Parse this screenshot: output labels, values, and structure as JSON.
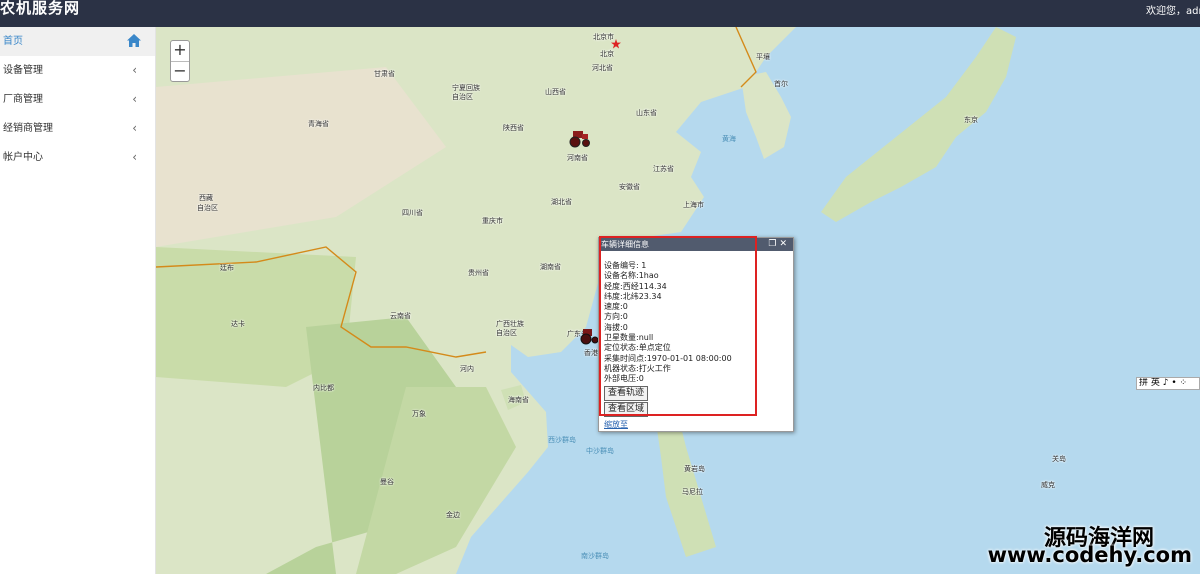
{
  "app": {
    "title": "农机服务网",
    "welcome": "欢迎您，admin"
  },
  "sidebar": {
    "items": [
      {
        "label": "首页",
        "icon": "home-icon",
        "active": true
      },
      {
        "label": "设备管理",
        "icon": "chevron-left-icon"
      },
      {
        "label": "厂商管理",
        "icon": "chevron-left-icon"
      },
      {
        "label": "经销商管理",
        "icon": "chevron-left-icon"
      },
      {
        "label": "帐户中心",
        "icon": "chevron-left-icon"
      }
    ]
  },
  "map": {
    "zoom_in": "+",
    "zoom_out": "−",
    "labels": {
      "beijing_city": "北京市",
      "beijing": "北京",
      "hebei": "河北省",
      "shanxi": "山西省",
      "gansu": "甘肃省",
      "ningxia": "宁夏回族",
      "ningxia2": "自治区",
      "qinghai": "青海省",
      "shaanxi": "陕西省",
      "henan": "河南省",
      "shandong": "山东省",
      "jiangsu": "江苏省",
      "anhui": "安徽省",
      "shanghai": "上海市",
      "hubei": "湖北省",
      "sichuan": "四川省",
      "chongqing": "重庆市",
      "hunan": "湖南省",
      "guizhou": "贵州省",
      "yunnan": "云南省",
      "guangxi": "广西壮族",
      "guangxi2": "自治区",
      "guangdong": "广东省",
      "xizang": "西藏",
      "xizang2": "自治区",
      "pyongyang": "平壤",
      "seoul": "首尔",
      "tokyo": "东京",
      "huanghai": "黄海",
      "thimphu": "廷布",
      "dhaka": "达卡",
      "naypyidaw": "内比都",
      "hanoi": "河内",
      "vientiane": "万象",
      "bangkok": "曼谷",
      "phnompenh": "金边",
      "haikou": "海南省",
      "xisha": "西沙群岛",
      "zhongsha": "中沙群岛",
      "huangyan": "黄岩岛",
      "manila": "马尼拉",
      "nansha": "南沙群岛",
      "xianggang": "香港",
      "guam": "关岛",
      "weike": "威克"
    }
  },
  "popup": {
    "title": "车辆详细信息",
    "controls": "❐✕",
    "lines": [
      "设备编号: 1",
      "设备名称:1hao",
      "经度:西经114.34",
      "纬度:北纬23.34",
      "速度:0",
      "方向:0",
      "海拔:0",
      "卫星数量:null",
      "定位状态:单点定位",
      "采集时间点:1970-01-01 08:00:00",
      "机器状态:打火工作",
      "外部电压:0"
    ],
    "btn_track": "查看轨迹",
    "btn_area": "查看区域",
    "zoom_link": "缩放至"
  },
  "ime": "拼 英 ♪ • ⁘",
  "watermark": {
    "line1": "源码海洋网",
    "line2": "www.codehy.com"
  }
}
